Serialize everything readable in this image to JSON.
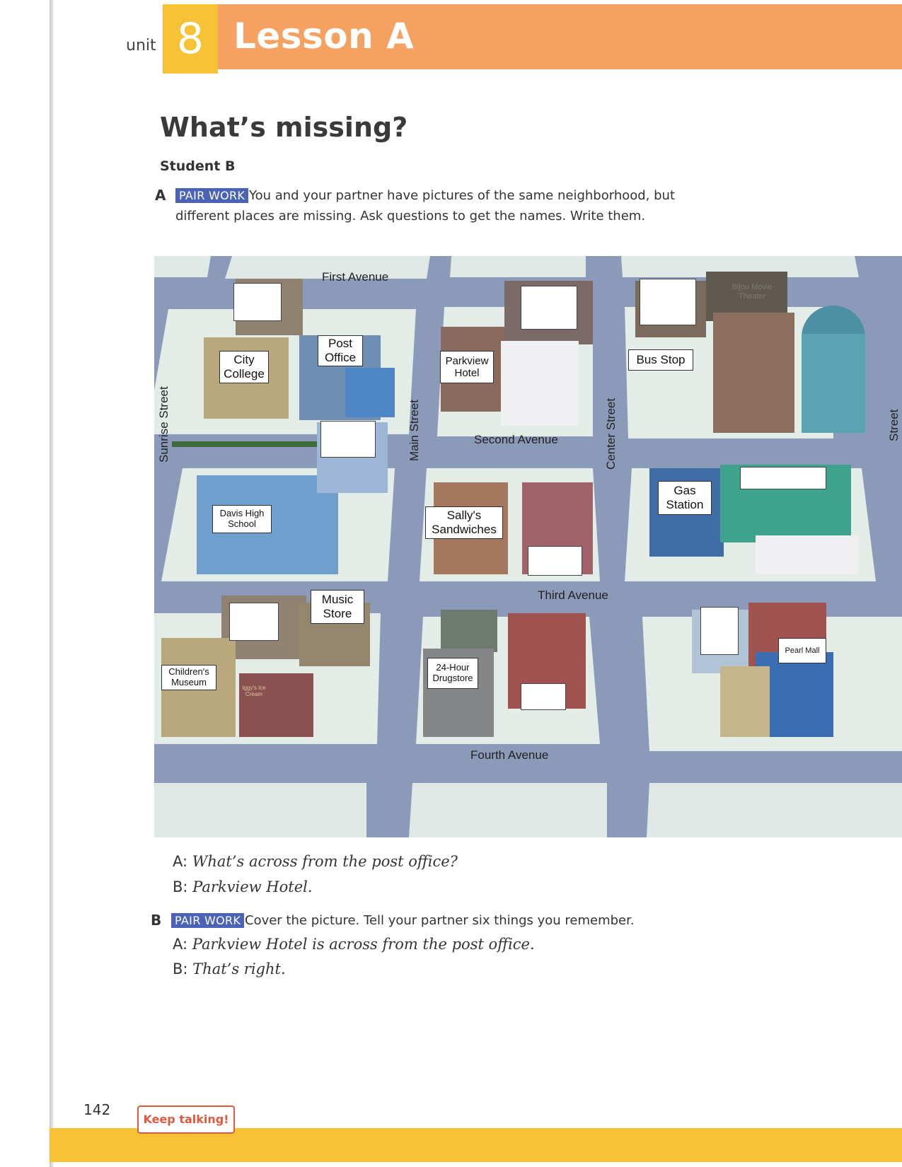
{
  "header": {
    "unit_label": "unit",
    "unit_number": "8",
    "lesson_title": "Lesson A"
  },
  "page_title": "What’s missing?",
  "student": "Student B",
  "section_a": {
    "letter": "A",
    "badge": "PAIR WORK",
    "line1": "You and your partner have pictures of the same neighborhood, but",
    "line2": "different places are missing. Ask questions to get the names. Write them."
  },
  "map": {
    "streets": {
      "first_avenue": "First Avenue",
      "second_avenue": "Second Avenue",
      "third_avenue": "Third Avenue",
      "fourth_avenue": "Fourth Avenue",
      "sunrise_street": "Sunrise Street",
      "main_street": "Main Street",
      "center_street": "Center Street",
      "right_street": "Street"
    },
    "places": {
      "city_college": "City College",
      "post_office": "Post Office",
      "parkview_hotel": "Parkview Hotel",
      "bus_stop": "Bus Stop",
      "bijou": "Bijou Movie Theater",
      "davis_high_school": "Davis High School",
      "sallys_sandwiches": "Sally's Sandwiches",
      "gas_station": "Gas Station",
      "music_store": "Music Store",
      "childrens_museum": "Children's Museum",
      "drugstore": "24-Hour Drugstore",
      "pearl_mall": "Pearl Mall",
      "iggys_ice_cream": "Iggy's Ice Cream"
    }
  },
  "dialog_a": [
    {
      "speaker": "A:",
      "text": "What’s across from the post office?"
    },
    {
      "speaker": "B:",
      "text": "Parkview Hotel."
    }
  ],
  "section_b": {
    "letter": "B",
    "badge": "PAIR WORK",
    "text": "Cover the picture. Tell your partner six things you remember."
  },
  "dialog_b": [
    {
      "speaker": "A:",
      "text": "Parkview Hotel is across from the post office."
    },
    {
      "speaker": "B:",
      "text": "That’s right."
    }
  ],
  "footer": {
    "page_number": "142",
    "keep_talking": "Keep talking!"
  },
  "colors": {
    "top_bar": "#f5a162",
    "unit_box": "#f7c236",
    "badge": "#4a63b6",
    "keep_talking": "#e2583e",
    "road": "#8b9ab8"
  }
}
